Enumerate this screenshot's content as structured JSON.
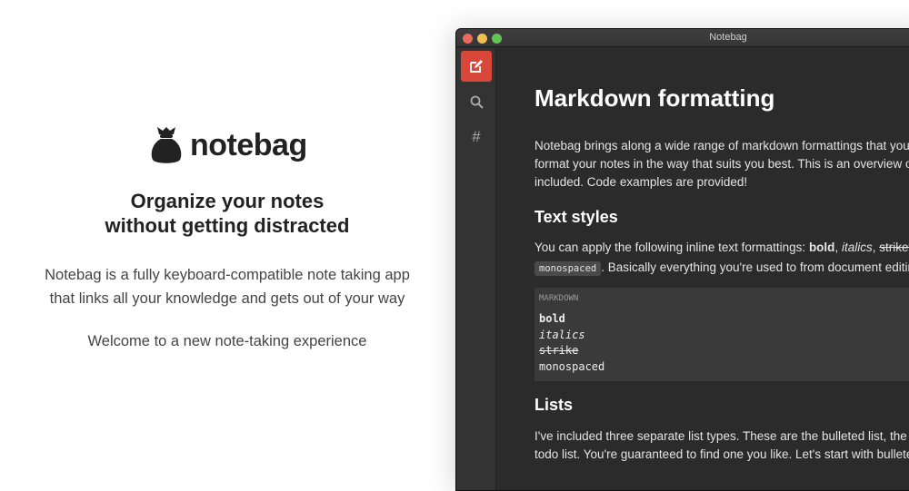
{
  "brand": {
    "name": "notebag",
    "icon": "money-bag-icon"
  },
  "hero": {
    "tagline_line1": "Organize your notes",
    "tagline_line2": "without getting distracted",
    "desc_line1": "Notebag is a fully keyboard-compatible note taking app",
    "desc_line2": "that links all your knowledge and gets out of your way",
    "welcome": "Welcome to a new note-taking experience"
  },
  "window": {
    "title": "Notebag",
    "colors": {
      "close": "#ed6a5e",
      "min": "#f5bf4f",
      "max": "#61c554",
      "accent": "#d9473a"
    }
  },
  "sidebar": {
    "items": [
      {
        "icon": "edit-icon"
      },
      {
        "icon": "search-icon"
      },
      {
        "icon": "hash-icon"
      }
    ]
  },
  "note": {
    "title": "Markdown formatting",
    "intro": [
      "Notebag brings along a wide range of markdown formattings that you can",
      "format your notes in the way that suits you best. This is an overview of every",
      "included. Code examples are provided!"
    ],
    "h_text_styles": "Text styles",
    "styles_pre": "You can apply the following inline text formattings: ",
    "bold": "bold",
    "comma": ", ",
    "italics": "italics",
    "strike": "strikethrough",
    "mono": "monospaced",
    "styles_post": ". Basically everything you're used to from document editing",
    "code": {
      "label": "MARKDOWN",
      "lines": [
        "bold",
        "italics",
        "strike",
        "monospaced"
      ]
    },
    "h_lists": "Lists",
    "lists": [
      "I've included three separate list types. These are the bulleted list, the ordered list and the",
      "todo list. You're guaranteed to find one you like. Let's start with bulleted."
    ]
  }
}
